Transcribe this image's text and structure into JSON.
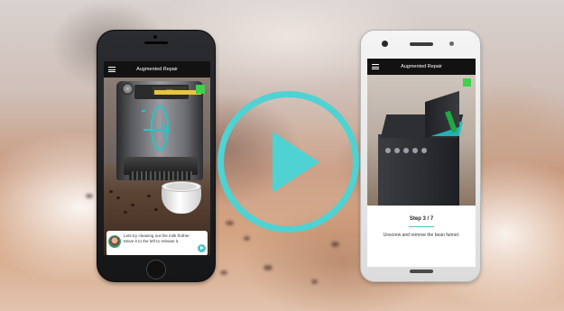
{
  "video": {
    "play_icon": "play-icon",
    "accent_color": "#4fd2d2"
  },
  "left_phone": {
    "app_title": "Augmented Repair",
    "menu_icon": "hamburger-menu-icon",
    "display_text": "[text unclear]",
    "chat": {
      "message": "Lets try cleaning out the milk frother. Move it to the left to release it.",
      "avatar_icon": "assistant-avatar",
      "send_icon": "play-arrow-icon"
    }
  },
  "right_phone": {
    "app_title": "Augmented Repair",
    "menu_icon": "hamburger-menu-icon",
    "step": {
      "title": "Step 3 / 7",
      "instruction": "Unscrew and remove the bean funnel."
    }
  }
}
